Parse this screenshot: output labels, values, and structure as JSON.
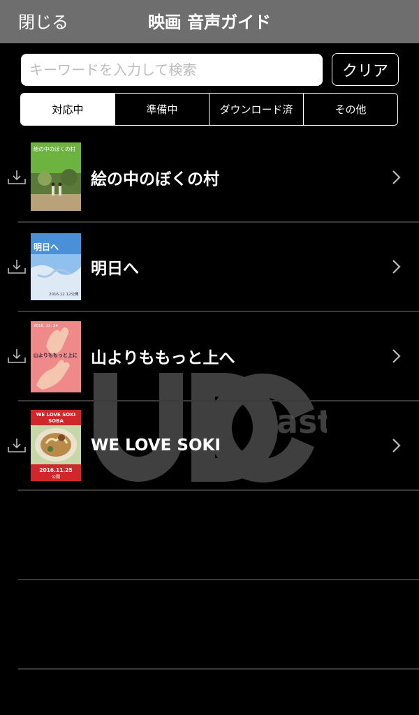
{
  "nav": {
    "close_label": "閉じる",
    "title": "映画 音声ガイド"
  },
  "search": {
    "placeholder": "キーワードを入力して検索",
    "value": "",
    "clear_label": "クリア"
  },
  "tabs": [
    {
      "label": "対応中",
      "active": true
    },
    {
      "label": "準備中",
      "active": false
    },
    {
      "label": "ダウンロード済",
      "active": false
    },
    {
      "label": "その他",
      "active": false
    }
  ],
  "watermark": {
    "text": "ast"
  },
  "movies": [
    {
      "title": "絵の中のぼくの村",
      "poster_text": "絵の中のぼくの村"
    },
    {
      "title": "明日へ",
      "poster_title": "明日へ",
      "poster_date": "2016.12.12公開"
    },
    {
      "title": "山よりももっと上へ",
      "poster_date": "2016. 12. 24",
      "poster_title": "山よりももっと上に"
    },
    {
      "title": "WE LOVE SOKI",
      "poster_line1": "WE LOVE SOKI",
      "poster_line2": "SOBA",
      "poster_date": "2016.11.25",
      "poster_sub": "公開"
    }
  ],
  "colors": {
    "navbar": "#6e6e6e",
    "background": "#000000",
    "divider": "#3a3a3a",
    "poster1_green": "#6cb33f",
    "poster2_blue": "#4a90d9",
    "poster3_pink": "#f08a8a",
    "poster4_red": "#d0282a"
  }
}
